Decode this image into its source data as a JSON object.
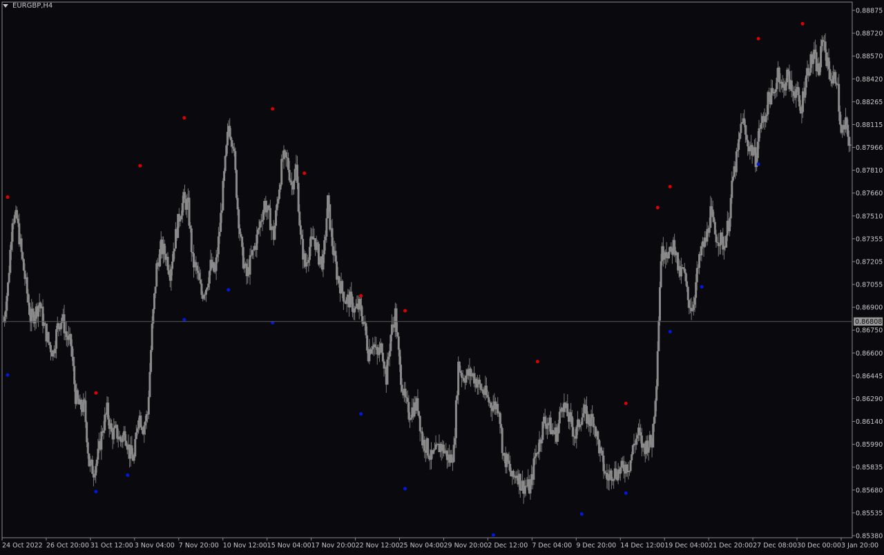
{
  "header": {
    "symbol_label": "EURGBP,H4"
  },
  "colors": {
    "background": "#0a0a0e",
    "frame": "#8c8c8c",
    "candle": "#8a8a8a",
    "wick": "#7a7a7a",
    "text": "#c8c8c8",
    "fractal_up": "#e00000",
    "fractal_down": "#0018e0",
    "price_line": "#5a5a5a",
    "price_tag_bg": "#9a9a9a",
    "price_tag_text": "#0a0a0e"
  },
  "chart_data": {
    "type": "candlestick",
    "symbol": "EURGBP",
    "timeframe": "H4",
    "current_price": 0.86808,
    "current_price_label": "0.86808",
    "y_ticks": [
      "0.88875",
      "0.88720",
      "0.88570",
      "0.88420",
      "0.88265",
      "0.88115",
      "0.87966",
      "0.87810",
      "0.87660",
      "0.87510",
      "0.87355",
      "0.87205",
      "0.87055",
      "0.86900",
      "0.86750",
      "0.86600",
      "0.86445",
      "0.86290",
      "0.86140",
      "0.85990",
      "0.85835",
      "0.85680",
      "0.85535",
      "0.85380"
    ],
    "y_range": [
      0.8538,
      0.8888
    ],
    "x_ticks": [
      "24 Oct 2022",
      "26 Oct 20:00",
      "31 Oct 12:00",
      "3 Nov 04:00",
      "7 Nov 20:00",
      "10 Nov 12:00",
      "15 Nov 04:00",
      "17 Nov 20:00",
      "22 Nov 12:00",
      "25 Nov 04:00",
      "29 Nov 20:00",
      "2 Dec 12:00",
      "7 Dec 04:00",
      "9 Dec 20:00",
      "14 Dec 12:00",
      "19 Dec 04:00",
      "21 Dec 20:00",
      "27 Dec 08:00",
      "30 Dec 00:00",
      "3 Jan 20:00"
    ],
    "price_path": [
      0.8681,
      0.8705,
      0.8751,
      0.8749,
      0.8726,
      0.8705,
      0.8683,
      0.8686,
      0.8694,
      0.8678,
      0.8667,
      0.866,
      0.8677,
      0.8684,
      0.8671,
      0.8665,
      0.8631,
      0.8623,
      0.8624,
      0.8586,
      0.8581,
      0.8591,
      0.8609,
      0.8621,
      0.8606,
      0.8607,
      0.8601,
      0.8607,
      0.8593,
      0.8589,
      0.862,
      0.861,
      0.8619,
      0.8676,
      0.8717,
      0.873,
      0.8726,
      0.8714,
      0.8734,
      0.8751,
      0.8762,
      0.8758,
      0.8721,
      0.8714,
      0.8699,
      0.8704,
      0.8718,
      0.8713,
      0.8742,
      0.8778,
      0.8812,
      0.8801,
      0.8757,
      0.8725,
      0.8711,
      0.8723,
      0.8733,
      0.8747,
      0.876,
      0.8751,
      0.8738,
      0.8766,
      0.879,
      0.8788,
      0.8772,
      0.8784,
      0.8736,
      0.8718,
      0.8731,
      0.8737,
      0.8724,
      0.872,
      0.8761,
      0.8733,
      0.8713,
      0.8703,
      0.8695,
      0.8695,
      0.8688,
      0.8691,
      0.8681,
      0.866,
      0.8668,
      0.8657,
      0.8665,
      0.8643,
      0.8672,
      0.8686,
      0.8649,
      0.863,
      0.8619,
      0.8623,
      0.8625,
      0.8601,
      0.8597,
      0.8589,
      0.8593,
      0.8598,
      0.8594,
      0.8588,
      0.8594,
      0.8652,
      0.8644,
      0.8645,
      0.8646,
      0.8641,
      0.8636,
      0.8632,
      0.8626,
      0.8625,
      0.8624,
      0.859,
      0.8586,
      0.8575,
      0.858,
      0.8571,
      0.8571,
      0.8569,
      0.859,
      0.86,
      0.8614,
      0.8613,
      0.8606,
      0.8606,
      0.8628,
      0.862,
      0.8613,
      0.8604,
      0.8616,
      0.862,
      0.8614,
      0.8616,
      0.86,
      0.8586,
      0.8575,
      0.858,
      0.858,
      0.8581,
      0.8584,
      0.8585,
      0.8599,
      0.8606,
      0.8596,
      0.8599,
      0.86,
      0.8643,
      0.8725,
      0.873,
      0.8725,
      0.8734,
      0.8712,
      0.8715,
      0.8695,
      0.869,
      0.8712,
      0.8729,
      0.8735,
      0.8754,
      0.8739,
      0.8736,
      0.8732,
      0.8747,
      0.8777,
      0.8793,
      0.8818,
      0.8801,
      0.8797,
      0.879,
      0.8812,
      0.8817,
      0.8832,
      0.8831,
      0.885,
      0.8835,
      0.8846,
      0.8835,
      0.8836,
      0.882,
      0.8842,
      0.8853,
      0.8858,
      0.8847,
      0.8872,
      0.8852,
      0.8842,
      0.8845,
      0.8805,
      0.8812,
      0.8799
    ],
    "fractals_up": [
      {
        "date": "24 Oct 2022",
        "price": 0.8764
      },
      {
        "date": "31 Oct 12:00",
        "price": 0.8633
      },
      {
        "date": "3 Nov 04:00",
        "price": 0.8785
      },
      {
        "date": "7 Nov 20:00",
        "price": 0.8817
      },
      {
        "date": "15 Nov 04:00",
        "price": 0.8823
      },
      {
        "date": "15 Nov 04:00",
        "price": 0.878
      },
      {
        "date": "22 Nov 12:00",
        "price": 0.8698
      },
      {
        "date": "25 Nov 04:00",
        "price": 0.8688
      },
      {
        "date": "7 Dec 04:00",
        "price": 0.8654
      },
      {
        "date": "14 Dec 12:00",
        "price": 0.8626
      },
      {
        "date": "14 Dec 12:00",
        "price": 0.8757
      },
      {
        "date": "19 Dec 04:00",
        "price": 0.8771
      },
      {
        "date": "27 Dec 08:00",
        "price": 0.887
      },
      {
        "date": "30 Dec 00:00",
        "price": 0.888
      }
    ],
    "fractals_down": [
      {
        "date": "24 Oct 2022",
        "price": 0.8645
      },
      {
        "date": "31 Oct 12:00",
        "price": 0.8567
      },
      {
        "date": "31 Oct 12:00",
        "price": 0.8578
      },
      {
        "date": "7 Nov 20:00",
        "price": 0.8682
      },
      {
        "date": "10 Nov 12:00",
        "price": 0.8702
      },
      {
        "date": "15 Nov 04:00",
        "price": 0.868
      },
      {
        "date": "22 Nov 12:00",
        "price": 0.8619
      },
      {
        "date": "25 Nov 04:00",
        "price": 0.8569
      },
      {
        "date": "2 Dec 12:00",
        "price": 0.8538
      },
      {
        "date": "9 Dec 20:00",
        "price": 0.8552
      },
      {
        "date": "14 Dec 12:00",
        "price": 0.8566
      },
      {
        "date": "19 Dec 04:00",
        "price": 0.8674
      },
      {
        "date": "19 Dec 04:00",
        "price": 0.8704
      },
      {
        "date": "27 Dec 08:00",
        "price": 0.8786
      }
    ]
  }
}
